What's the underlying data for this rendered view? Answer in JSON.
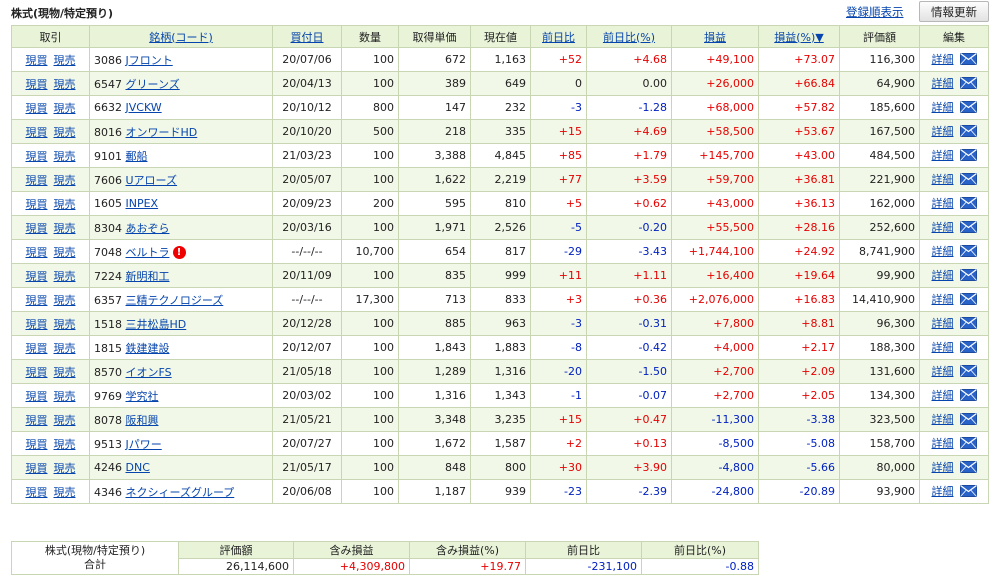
{
  "header": {
    "section_title": "株式(現物/特定預り)",
    "sort_link": "登録順表示",
    "refresh_button": "情報更新"
  },
  "columns": [
    "取引",
    "銘柄(コード)",
    "買付日",
    "数量",
    "取得単価",
    "現在値",
    "前日比",
    "前日比(%)",
    "損益",
    "損益(%)▼",
    "評価額",
    "編集"
  ],
  "trade_buy": "現買",
  "trade_sell": "現売",
  "detail_label": "詳細",
  "rows": [
    {
      "code": "3086",
      "name": "Jフロント",
      "date": "20/07/06",
      "qty": "100",
      "cost": "672",
      "price": "1,163",
      "chg": "+52",
      "chgp": "+4.68",
      "pl": "+49,100",
      "plp": "+73.07",
      "val": "116,300"
    },
    {
      "code": "6547",
      "name": "グリーンズ",
      "date": "20/04/13",
      "qty": "100",
      "cost": "389",
      "price": "649",
      "chg": "0",
      "chgp": "0.00",
      "pl": "+26,000",
      "plp": "+66.84",
      "val": "64,900"
    },
    {
      "code": "6632",
      "name": "JVCKW",
      "date": "20/10/12",
      "qty": "800",
      "cost": "147",
      "price": "232",
      "chg": "-3",
      "chgp": "-1.28",
      "pl": "+68,000",
      "plp": "+57.82",
      "val": "185,600"
    },
    {
      "code": "8016",
      "name": "オンワードHD",
      "date": "20/10/20",
      "qty": "500",
      "cost": "218",
      "price": "335",
      "chg": "+15",
      "chgp": "+4.69",
      "pl": "+58,500",
      "plp": "+53.67",
      "val": "167,500"
    },
    {
      "code": "9101",
      "name": "郵船",
      "date": "21/03/23",
      "qty": "100",
      "cost": "3,388",
      "price": "4,845",
      "chg": "+85",
      "chgp": "+1.79",
      "pl": "+145,700",
      "plp": "+43.00",
      "val": "484,500"
    },
    {
      "code": "7606",
      "name": "Uアローズ",
      "date": "20/05/07",
      "qty": "100",
      "cost": "1,622",
      "price": "2,219",
      "chg": "+77",
      "chgp": "+3.59",
      "pl": "+59,700",
      "plp": "+36.81",
      "val": "221,900"
    },
    {
      "code": "1605",
      "name": "INPEX",
      "date": "20/09/23",
      "qty": "200",
      "cost": "595",
      "price": "810",
      "chg": "+5",
      "chgp": "+0.62",
      "pl": "+43,000",
      "plp": "+36.13",
      "val": "162,000"
    },
    {
      "code": "8304",
      "name": "あおぞら",
      "date": "20/03/16",
      "qty": "100",
      "cost": "1,971",
      "price": "2,526",
      "chg": "-5",
      "chgp": "-0.20",
      "pl": "+55,500",
      "plp": "+28.16",
      "val": "252,600"
    },
    {
      "code": "7048",
      "name": "ベルトラ",
      "date": "--/--/--",
      "qty": "10,700",
      "cost": "654",
      "price": "817",
      "chg": "-29",
      "chgp": "-3.43",
      "pl": "+1,744,100",
      "plp": "+24.92",
      "val": "8,741,900",
      "warn": "!"
    },
    {
      "code": "7224",
      "name": "新明和工",
      "date": "20/11/09",
      "qty": "100",
      "cost": "835",
      "price": "999",
      "chg": "+11",
      "chgp": "+1.11",
      "pl": "+16,400",
      "plp": "+19.64",
      "val": "99,900"
    },
    {
      "code": "6357",
      "name": "三精テクノロジーズ",
      "date": "--/--/--",
      "qty": "17,300",
      "cost": "713",
      "price": "833",
      "chg": "+3",
      "chgp": "+0.36",
      "pl": "+2,076,000",
      "plp": "+16.83",
      "val": "14,410,900"
    },
    {
      "code": "1518",
      "name": "三井松島HD",
      "date": "20/12/28",
      "qty": "100",
      "cost": "885",
      "price": "963",
      "chg": "-3",
      "chgp": "-0.31",
      "pl": "+7,800",
      "plp": "+8.81",
      "val": "96,300"
    },
    {
      "code": "1815",
      "name": "鉄建建設",
      "date": "20/12/07",
      "qty": "100",
      "cost": "1,843",
      "price": "1,883",
      "chg": "-8",
      "chgp": "-0.42",
      "pl": "+4,000",
      "plp": "+2.17",
      "val": "188,300"
    },
    {
      "code": "8570",
      "name": "イオンFS",
      "date": "21/05/18",
      "qty": "100",
      "cost": "1,289",
      "price": "1,316",
      "chg": "-20",
      "chgp": "-1.50",
      "pl": "+2,700",
      "plp": "+2.09",
      "val": "131,600"
    },
    {
      "code": "9769",
      "name": "学究社",
      "date": "20/03/02",
      "qty": "100",
      "cost": "1,316",
      "price": "1,343",
      "chg": "-1",
      "chgp": "-0.07",
      "pl": "+2,700",
      "plp": "+2.05",
      "val": "134,300"
    },
    {
      "code": "8078",
      "name": "阪和興",
      "date": "21/05/21",
      "qty": "100",
      "cost": "3,348",
      "price": "3,235",
      "chg": "+15",
      "chgp": "+0.47",
      "pl": "-11,300",
      "plp": "-3.38",
      "val": "323,500"
    },
    {
      "code": "9513",
      "name": "Jパワー",
      "date": "20/07/27",
      "qty": "100",
      "cost": "1,672",
      "price": "1,587",
      "chg": "+2",
      "chgp": "+0.13",
      "pl": "-8,500",
      "plp": "-5.08",
      "val": "158,700"
    },
    {
      "code": "4246",
      "name": "DNC",
      "date": "21/05/17",
      "qty": "100",
      "cost": "848",
      "price": "800",
      "chg": "+30",
      "chgp": "+3.90",
      "pl": "-4,800",
      "plp": "-5.66",
      "val": "80,000"
    },
    {
      "code": "4346",
      "name": "ネクシィーズグループ",
      "date": "20/06/08",
      "qty": "100",
      "cost": "1,187",
      "price": "939",
      "chg": "-23",
      "chgp": "-2.39",
      "pl": "-24,800",
      "plp": "-20.89",
      "val": "93,900"
    }
  ],
  "summary": {
    "label_line1": "株式(現物/特定預り)",
    "label_line2": "合計",
    "headers": [
      "評価額",
      "含み損益",
      "含み損益(%)",
      "前日比",
      "前日比(%)"
    ],
    "values": [
      "26,114,600",
      "+4,309,800",
      "+19.77",
      "-231,100",
      "-0.88"
    ]
  },
  "colors": {
    "positive": "#e60000",
    "negative": "#0020c0",
    "header_bg": "#e8f3d8",
    "row_alt_bg": "#f2f8e8",
    "link": "#0645ad"
  },
  "icons": {
    "mail": "envelope-icon",
    "warning": "alert-icon"
  }
}
